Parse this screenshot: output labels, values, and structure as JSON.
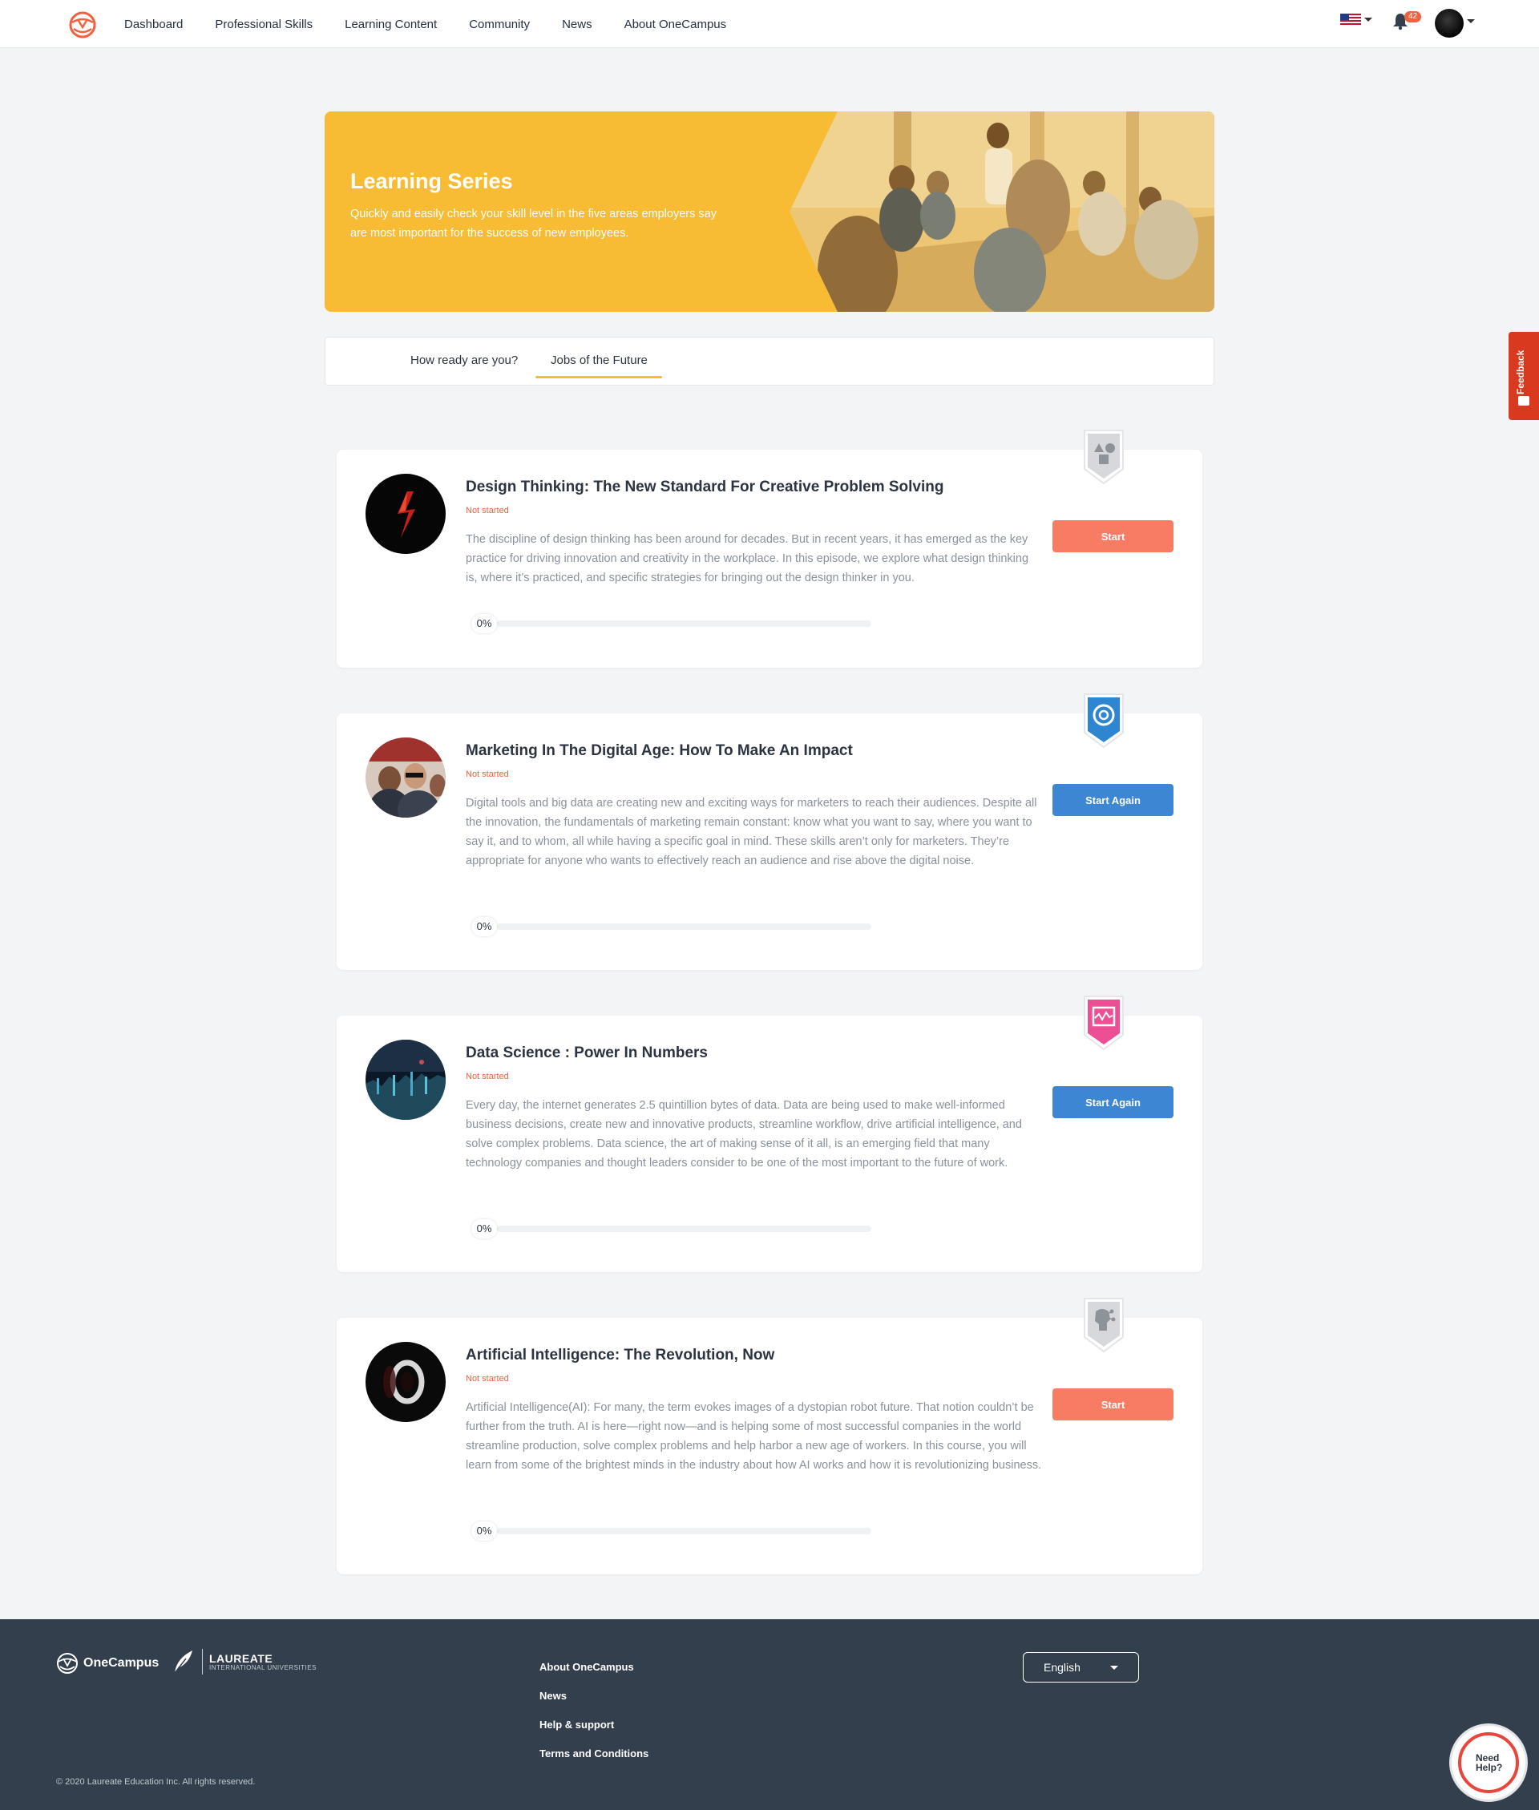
{
  "nav": {
    "items": [
      "Dashboard",
      "Professional Skills",
      "Learning Content",
      "Community",
      "News",
      "About OneCampus"
    ],
    "notifications_count": "42"
  },
  "banner": {
    "title": "Learning Series",
    "subtitle": "Quickly and easily check your skill level in the five areas employers say are most important for the success of new employees."
  },
  "tabs": [
    {
      "label": "How ready are you?",
      "active": false
    },
    {
      "label": "Jobs of the Future",
      "active": true
    }
  ],
  "courses": [
    {
      "title": "Design Thinking: The New Standard For Creative Problem Solving",
      "status": "Not started",
      "description": "The discipline of design thinking has been around for decades. But in recent years, it has emerged as the key practice for driving innovation and creativity in the workplace. In this episode, we explore what design thinking is, where it’s practiced, and specific strategies for bringing out the design thinker in you.",
      "progress_label": "0%",
      "progress_fraction": 0,
      "button": "Start",
      "badge_icon": "shapes-icon",
      "badge_color": "#d6d8dc"
    },
    {
      "title": "Marketing In The Digital Age: How To Make An Impact",
      "status": "Not started",
      "description": "Digital tools and big data are creating new and exciting ways for marketers to reach their audiences. Despite all the innovation, the fundamentals of marketing remain constant: know what you want to say, where you want to say it, and to whom, all while having a specific goal in mind. These skills aren’t only for marketers. They’re appropriate for anyone who wants to effectively reach an audience and rise above the digital noise.",
      "progress_label": "0%",
      "progress_fraction": 0,
      "button": "Start Again",
      "badge_icon": "target-icon",
      "badge_color": "#2f86d0"
    },
    {
      "title": "Data Science : Power In Numbers",
      "status": "Not started",
      "description": "Every day, the internet generates 2.5 quintillion bytes of data. Data are being used to make well-informed business decisions, create new and innovative products, streamline workflow, drive artificial intelligence, and solve complex problems. Data science, the art of making sense of it all, is an emerging field that many technology companies and thought leaders consider to be one of the most important to the future of work.",
      "progress_label": "0%",
      "progress_fraction": 0,
      "button": "Start Again",
      "badge_icon": "data-chart-icon",
      "badge_color": "#ec4f93"
    },
    {
      "title": "Artificial Intelligence: The Revolution, Now",
      "status": "Not started",
      "description": "Artificial Intelligence(AI): For many, the term evokes images of a dystopian robot future. That notion couldn’t be further from the truth. AI is here—right now—and is helping some of most successful companies in the world streamline production, solve complex problems and help harbor a new age of workers. In this course, you will learn from some of the brightest minds in the industry about how AI works and how it is revolutionizing business.",
      "progress_label": "0%",
      "progress_fraction": 0,
      "button": "Start",
      "badge_icon": "ai-head-icon",
      "badge_color": "#d6d8dc"
    }
  ],
  "feedback": {
    "label": "Feedback"
  },
  "footer": {
    "brand": "OneCampus",
    "partner": "LAUREATE",
    "partner_sub": "INTERNATIONAL UNIVERSITIES",
    "links": [
      "About OneCampus",
      "News",
      "Help & support",
      "Terms and Conditions"
    ],
    "language": "English",
    "copyright": "© 2020 Laureate Education Inc. All rights reserved.",
    "need_help": "Need Help?"
  },
  "colors": {
    "accent_orange": "#f87c63",
    "accent_blue": "#3d86d3",
    "banner_yellow": "#f7bc33",
    "status_red": "#f0613e",
    "footer_bg": "#333f4d"
  }
}
